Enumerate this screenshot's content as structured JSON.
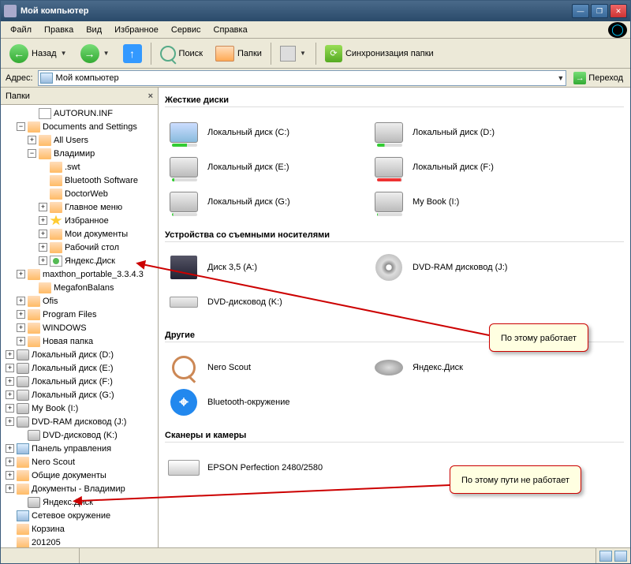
{
  "window": {
    "title": "Мой компьютер"
  },
  "menu": {
    "file": "Файл",
    "edit": "Правка",
    "view": "Вид",
    "fav": "Избранное",
    "service": "Сервис",
    "help": "Справка"
  },
  "toolbar": {
    "back": "Назад",
    "search": "Поиск",
    "folders": "Папки",
    "sync": "Синхронизация папки"
  },
  "address": {
    "label": "Адрес:",
    "value": "Мой компьютер",
    "go": "Переход"
  },
  "sidebar": {
    "title": "Папки"
  },
  "tree": {
    "autorun": "AUTORUN.INF",
    "docset": "Documents and Settings",
    "allusers": "All Users",
    "vladimir": "Владимир",
    "swt": ".swt",
    "btsw": "Bluetooth Software",
    "doctorweb": "DoctorWeb",
    "mainmenu": "Главное меню",
    "fav": "Избранное",
    "mydocs": "Мои документы",
    "desktop": "Рабочий стол",
    "yandex": "Яндекс.Диск",
    "maxthon": "maxthon_portable_3.3.4.3",
    "megafon": "MegafonBalans",
    "ofis": "Ofis",
    "progfiles": "Program Files",
    "windows": "WINDOWS",
    "newfolder": "Новая папка",
    "diskd": "Локальный диск (D:)",
    "diske": "Локальный диск (E:)",
    "diskf": "Локальный диск (F:)",
    "diskg": "Локальный диск (G:)",
    "mybook": "My Book (I:)",
    "dvdram": "DVD-RAM дисковод (J:)",
    "dvdk": "DVD-дисковод (K:)",
    "cpanel": "Панель управления",
    "nero": "Nero Scout",
    "shareddocs": "Общие документы",
    "docsvlad": "Документы - Владимир",
    "yandex2": "Яндекс.Диск",
    "network": "Сетевое окружение",
    "recycle": "Корзина",
    "num": "201205"
  },
  "sections": {
    "hdd": "Жесткие диски",
    "removable": "Устройства со съемными носителями",
    "other": "Другие",
    "scanners": "Сканеры и камеры"
  },
  "drives": {
    "c": "Локальный диск (C:)",
    "d": "Локальный диск (D:)",
    "e": "Локальный диск (E:)",
    "f": "Локальный диск (F:)",
    "g": "Локальный диск (G:)",
    "i": "My Book (I:)",
    "floppy": "Диск 3,5 (A:)",
    "dvdram": "DVD-RAM дисковод (J:)",
    "dvdk": "DVD-дисковод (K:)",
    "nero": "Nero Scout",
    "yandex": "Яндекс.Диск",
    "bt": "Bluetooth-окружение",
    "scanner": "EPSON Perfection 2480/2580"
  },
  "callouts": {
    "c1": "По этому работает",
    "c2": "По этому пути не работает"
  }
}
